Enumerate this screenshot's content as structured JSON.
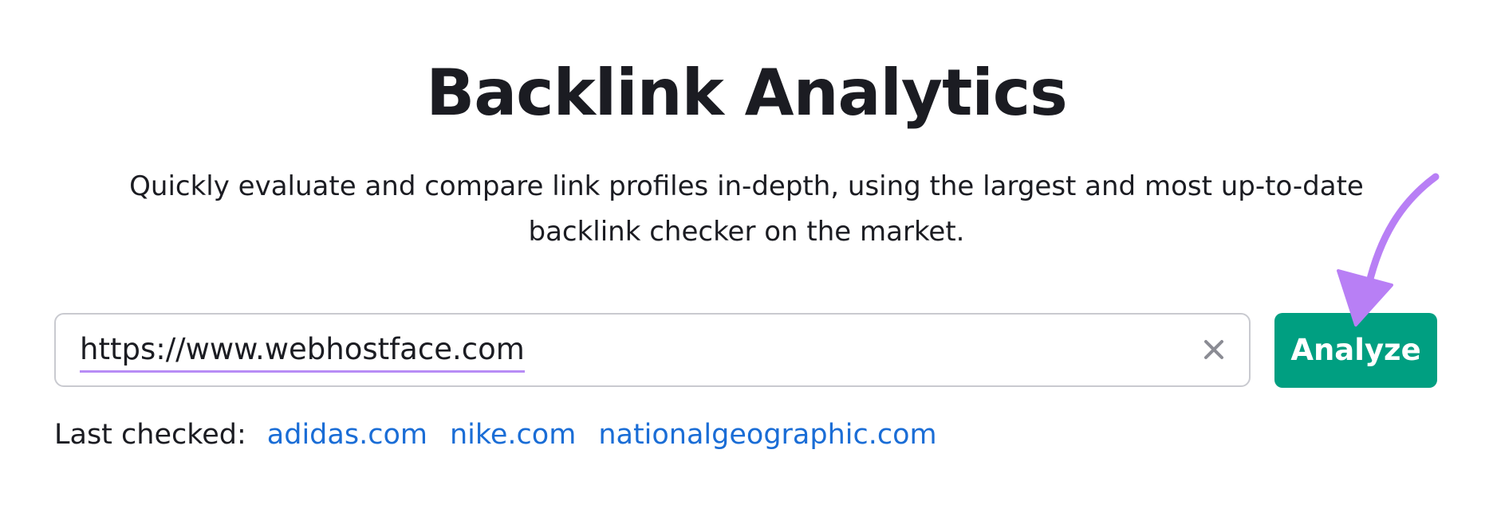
{
  "page": {
    "title": "Backlink Analytics",
    "subtitle": "Quickly evaluate and compare link profiles in-depth, using the largest and most up-to-date backlink checker on the market."
  },
  "search": {
    "value": "https://www.webhostface.com",
    "clear_icon": "close-icon",
    "button_label": "Analyze"
  },
  "last_checked": {
    "label": "Last checked:",
    "links": [
      "adidas.com",
      "nike.com",
      "nationalgeographic.com"
    ]
  },
  "colors": {
    "button_bg": "#009f81",
    "link": "#1a6dd6",
    "annotation_arrow": "#b87ff5",
    "input_underline": "#b88cf5"
  },
  "icons": {
    "annotation": "arrow-pointer-icon"
  }
}
